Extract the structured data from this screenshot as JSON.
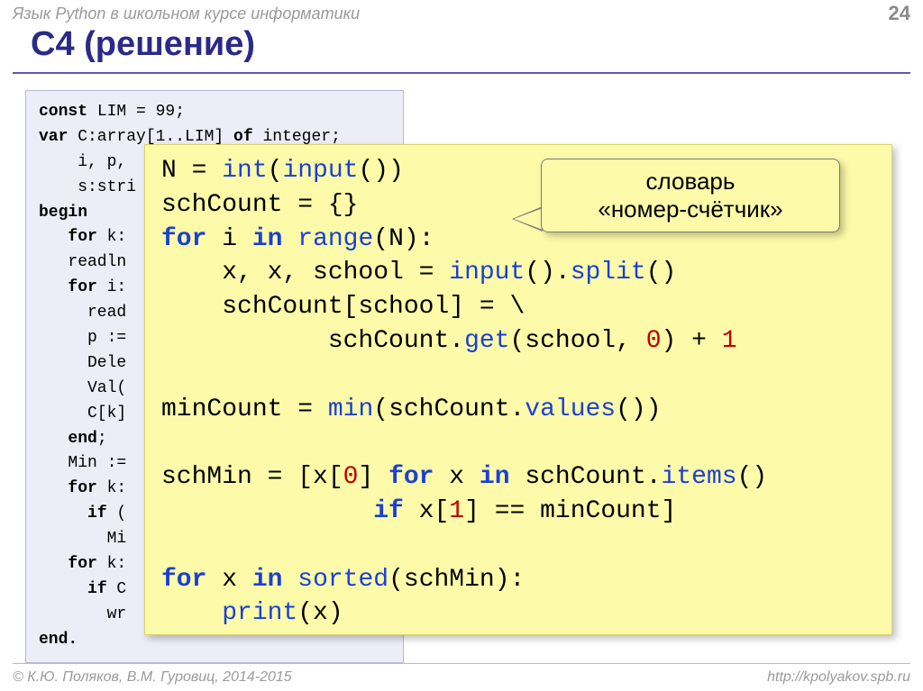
{
  "header": {
    "course": "Язык Python в школьном курсе информатики",
    "page": "24"
  },
  "title": "C4 (решение)",
  "pascal": {
    "l1a": "const",
    "l1b": " LIM = 99;",
    "l2a": "var",
    "l2b": " C:array[1..LIM] ",
    "l2c": "of",
    "l2d": " integer;",
    "l3": "    i, p,",
    "l4": "    s:stri",
    "l5": "begin",
    "l6a": "   ",
    "l6b": "for",
    "l6c": " k:",
    "l7": "   readln",
    "l8a": "   ",
    "l8b": "for",
    "l8c": " i:",
    "l9": "     read",
    "l10": "     p :=",
    "l11": "     Dele",
    "l12": "     Val(",
    "l13": "     C[k]",
    "l14a": "   ",
    "l14b": "end",
    "l14c": ";",
    "l15": "   Min :=",
    "l16a": "   ",
    "l16b": "for",
    "l16c": " k:",
    "l17a": "     ",
    "l17b": "if",
    "l17c": " (",
    "l18": "       Mi",
    "l19a": "   ",
    "l19b": "for",
    "l19c": " k:",
    "l20a": "     ",
    "l20b": "if",
    "l20c": " C",
    "l21": "       wr",
    "l22": "end."
  },
  "python": {
    "l1a": "N = ",
    "l1b": "int",
    "l1c": "(",
    "l1d": "input",
    "l1e": "())",
    "l2": "schCount = {}",
    "l3a": "for",
    "l3b": " i ",
    "l3c": "in",
    "l3d": " ",
    "l3e": "range",
    "l3f": "(N):",
    "l4a": "    x, x, school = ",
    "l4b": "input",
    "l4c": "().",
    "l4d": "split",
    "l4e": "()",
    "l5": "    schCount[school] = \\",
    "l6a": "           schCount.",
    "l6b": "get",
    "l6c": "(school, ",
    "l6d": "0",
    "l6e": ") + ",
    "l6f": "1",
    "l7a": "minCount = ",
    "l7b": "min",
    "l7c": "(schCount.",
    "l7d": "values",
    "l7e": "())",
    "l8a": "schMin = [x[",
    "l8b": "0",
    "l8c": "] ",
    "l8d": "for",
    "l8e": " x ",
    "l8f": "in",
    "l8g": " schCount.",
    "l8h": "items",
    "l8i": "()",
    "l9a": "              ",
    "l9b": "if",
    "l9c": " x[",
    "l9d": "1",
    "l9e": "] == minCount]",
    "l10a": "for",
    "l10b": " x ",
    "l10c": "in",
    "l10d": " ",
    "l10e": "sorted",
    "l10f": "(schMin):",
    "l11a": "    ",
    "l11b": "print",
    "l11c": "(x)"
  },
  "callout": {
    "line1": "словарь",
    "line2": "«номер-счётчик»"
  },
  "footer": {
    "left": "© К.Ю. Поляков, В.М. Гуровиц, 2014-2015",
    "right": "http://kpolyakov.spb.ru"
  }
}
